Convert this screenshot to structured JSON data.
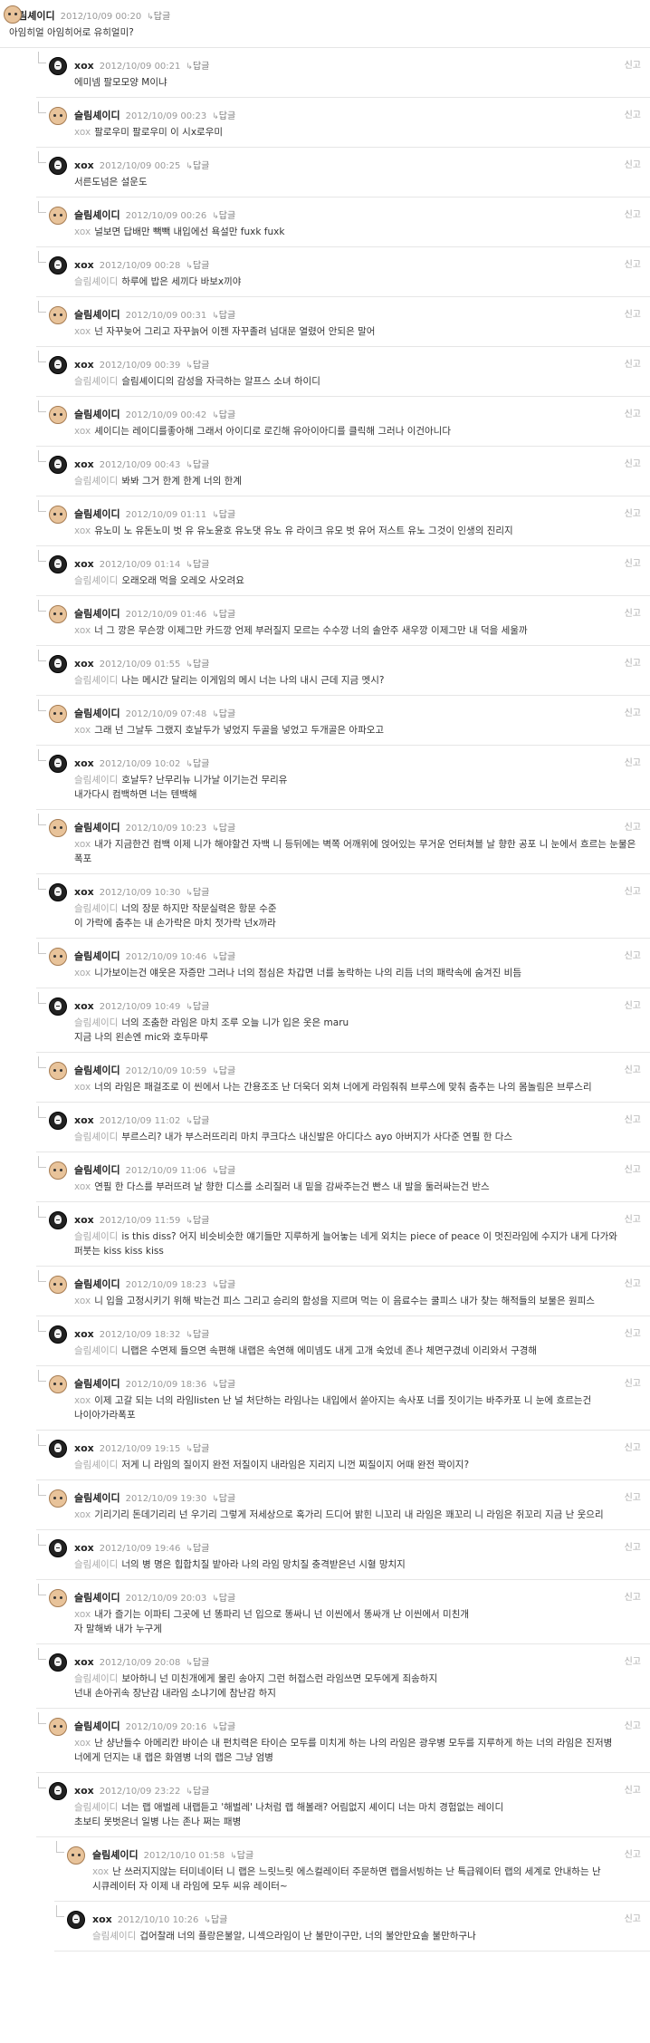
{
  "report_label": "신고",
  "reply_label": "답글",
  "reply_icon": "↳",
  "comments": [
    {
      "depth": 0,
      "author": "슬림셰이디",
      "avatar": "slim",
      "date": "2012/10/09 00:20",
      "report": false,
      "mention": "",
      "text": "아임히얼 아임히어로 유히얼미?"
    },
    {
      "depth": 1,
      "author": "xox",
      "avatar": "xox",
      "date": "2012/10/09 00:21",
      "report": true,
      "mention": "",
      "text": "에미넴 팔모모양 M이냐"
    },
    {
      "depth": 1,
      "author": "슬림셰이디",
      "avatar": "slim",
      "date": "2012/10/09 00:23",
      "report": true,
      "mention": "xox",
      "text": "팔로우미 팔로우미 이 시x로우미"
    },
    {
      "depth": 1,
      "author": "xox",
      "avatar": "xox",
      "date": "2012/10/09 00:25",
      "report": true,
      "mention": "",
      "text": "서른도넘은 설운도"
    },
    {
      "depth": 1,
      "author": "슬림셰이디",
      "avatar": "slim",
      "date": "2012/10/09 00:26",
      "report": true,
      "mention": "xox",
      "text": "널보면 답배만 빽빽 내입에선 욕설만 fuxk fuxk"
    },
    {
      "depth": 1,
      "author": "xox",
      "avatar": "xox",
      "date": "2012/10/09 00:28",
      "report": true,
      "mention": "슬림셰이디",
      "text": "하루에 밥은 세끼다 바보x끼야"
    },
    {
      "depth": 1,
      "author": "슬림셰이디",
      "avatar": "slim",
      "date": "2012/10/09 00:31",
      "report": true,
      "mention": "xox",
      "text": "넌 자꾸늦어 그리고 자꾸늙어 이젠 자꾸졸려 넘대문 열렸어 안되은 말어"
    },
    {
      "depth": 1,
      "author": "xox",
      "avatar": "xox",
      "date": "2012/10/09 00:39",
      "report": true,
      "mention": "슬림셰이디",
      "text": "슬림셰이디의 감성을 자극하는 알프스 소녀 하이디"
    },
    {
      "depth": 1,
      "author": "슬림셰이디",
      "avatar": "slim",
      "date": "2012/10/09 00:42",
      "report": true,
      "mention": "xox",
      "text": "셰이디는 레이디를좋아해 그래서 아이디로 로긴해 유아이아디를 클릭해 그러나 이건아니다"
    },
    {
      "depth": 1,
      "author": "xox",
      "avatar": "xox",
      "date": "2012/10/09 00:43",
      "report": true,
      "mention": "슬림셰이디",
      "text": "봐봐 그거 한계 한계 너의 한계"
    },
    {
      "depth": 1,
      "author": "슬림셰이디",
      "avatar": "slim",
      "date": "2012/10/09 01:11",
      "report": true,
      "mention": "xox",
      "text": "유노미 노 유돈노미 벗 유 유노윤호 유노댓 유노 유 라이크 유모 벗 유어 저스트 유노 그것이 인생의 진리지"
    },
    {
      "depth": 1,
      "author": "xox",
      "avatar": "xox",
      "date": "2012/10/09 01:14",
      "report": true,
      "mention": "슬림셰이디",
      "text": "오래오래 먹을 오레오 사오려요"
    },
    {
      "depth": 1,
      "author": "슬림셰이디",
      "avatar": "slim",
      "date": "2012/10/09 01:46",
      "report": true,
      "mention": "xox",
      "text": "너 그 깡은 무슨깡 이제그만 카드깡 언제 부러질지 모르는 수수깡 너의 솔안주 새우깡 이제그만 내 덕을 세울까"
    },
    {
      "depth": 1,
      "author": "xox",
      "avatar": "xox",
      "date": "2012/10/09 01:55",
      "report": true,
      "mention": "슬림셰이디",
      "text": "나는 메시간 달리는 이게임의 메시 너는 나의 내시 근데 지금 멧시?"
    },
    {
      "depth": 1,
      "author": "슬림셰이디",
      "avatar": "slim",
      "date": "2012/10/09 07:48",
      "report": true,
      "mention": "xox",
      "text": "그래 넌 그날두 그랬지 호날두가 넣었지 두골을 넣었고 두개골은 아파오고"
    },
    {
      "depth": 1,
      "author": "xox",
      "avatar": "xox",
      "date": "2012/10/09 10:02",
      "report": true,
      "mention": "슬림셰이디",
      "text": "호날두? 난무리뉴 니가날 이기는건 무리유\n내가다시 컴백하면 너는 텐백해"
    },
    {
      "depth": 1,
      "author": "슬림셰이디",
      "avatar": "slim",
      "date": "2012/10/09 10:23",
      "report": true,
      "mention": "xox",
      "text": "내가 지금한건 컴백 이제 니가 해야할건 자백 니 등뒤에는 벽쪽 어깨위에 얹어있는 무거운 언터쳐블 날 향한 공포 니 눈에서 흐르는 눈물은 폭포"
    },
    {
      "depth": 1,
      "author": "xox",
      "avatar": "xox",
      "date": "2012/10/09 10:30",
      "report": true,
      "mention": "슬림셰이디",
      "text": "너의 장문 하지만 작문실력은 항문 수준\n이 가락에 춤추는 내 손가락은 마치 젓가락 넌x까라"
    },
    {
      "depth": 1,
      "author": "슬림셰이디",
      "avatar": "slim",
      "date": "2012/10/09 10:46",
      "report": true,
      "mention": "xox",
      "text": "니가보이는건 얘웃은 자증만 그러나 너의 점심은 차갑면 너를 농락하는 나의 리듬 너의 패락속에 숨겨진 비듬"
    },
    {
      "depth": 1,
      "author": "xox",
      "avatar": "xox",
      "date": "2012/10/09 10:49",
      "report": true,
      "mention": "슬림셰이디",
      "text": "너의 조춤한 라임은 마치 조루 오늘 니가 입은 옷은 maru\n지금 나의 왼손엔 mic와 호두마루"
    },
    {
      "depth": 1,
      "author": "슬림셰이디",
      "avatar": "slim",
      "date": "2012/10/09 10:59",
      "report": true,
      "mention": "xox",
      "text": "너의 라임은 패걸조로 이 씬에서 나는 간용조조 난 더욱더 외쳐 너에게 라임줘줘 브루스에 맞춰 춤추는 나의 몸놀림은 브루스리"
    },
    {
      "depth": 1,
      "author": "xox",
      "avatar": "xox",
      "date": "2012/10/09 11:02",
      "report": true,
      "mention": "슬림셰이디",
      "text": "부르스리? 내가 부스러뜨리리 마치 쿠크다스 내신발은 아디다스 ayo 아버지가 사다준 연필 한 다스"
    },
    {
      "depth": 1,
      "author": "슬림셰이디",
      "avatar": "slim",
      "date": "2012/10/09 11:06",
      "report": true,
      "mention": "xox",
      "text": "연필 한 다스를 부러뜨려 날 향한 디스를 소리질러 내 밑을 감싸주는건 빤스 내 발을 둘러싸는건 반스"
    },
    {
      "depth": 1,
      "author": "xox",
      "avatar": "xox",
      "date": "2012/10/09 11:59",
      "report": true,
      "mention": "슬림셰이디",
      "text": "is this diss? 어지 비슷비슷한 얘기들만 지루하게 늘어놓는 네게 외치는 piece of peace 이 멋진라임에 수지가 내게 다가와 퍼붓는 kiss kiss kiss"
    },
    {
      "depth": 1,
      "author": "슬림셰이디",
      "avatar": "slim",
      "date": "2012/10/09 18:23",
      "report": true,
      "mention": "xox",
      "text": "니 입을 고정시키기 위해 박는건 피스 그리고 승리의 함성을 지르며 먹는 이 음료수는 쿨피스 내가 찾는 해적들의 보물은 원피스"
    },
    {
      "depth": 1,
      "author": "xox",
      "avatar": "xox",
      "date": "2012/10/09 18:32",
      "report": true,
      "mention": "슬림셰이디",
      "text": "니랩은 수면제 들으면 속편해 내랩은 속연해 에미넴도 내게 고개 숙었네 존나 체면구겼네 이리와서 구경해"
    },
    {
      "depth": 1,
      "author": "슬림셰이디",
      "avatar": "slim",
      "date": "2012/10/09 18:36",
      "report": true,
      "mention": "xox",
      "text": "이제 고갈 되는 너의 라임listen 난 널 처단하는 라임나는 내입에서 쏟아지는 속사포 너를 짓이기는 바주카포 니 눈에 흐르는건 나이아가라폭포"
    },
    {
      "depth": 1,
      "author": "xox",
      "avatar": "xox",
      "date": "2012/10/09 19:15",
      "report": true,
      "mention": "슬림셰이디",
      "text": "저게 니 라임의 질이지 완전 저질이지 내라임은 지리지 니껀 찌질이지 어때 완전 꽉이지?"
    },
    {
      "depth": 1,
      "author": "슬림셰이디",
      "avatar": "slim",
      "date": "2012/10/09 19:30",
      "report": true,
      "mention": "xox",
      "text": "기리기리 돈데기리리 넌 우기리 그렇게 저세상으로 혹가리 드디어 밝힌 니꼬리 내 라임은 꽤꼬리 니 라임은 쥐꼬리 지금 난 웃으리"
    },
    {
      "depth": 1,
      "author": "xox",
      "avatar": "xox",
      "date": "2012/10/09 19:46",
      "report": true,
      "mention": "슬림셰이디",
      "text": "너의 병 명은 힙합치질 밭아라 나의 라임 망치질 충격받은넌 시혈 망치지"
    },
    {
      "depth": 1,
      "author": "슬림셰이디",
      "avatar": "slim",
      "date": "2012/10/09 20:03",
      "report": true,
      "mention": "xox",
      "text": "내가 즐기는 이파티 그곳에 넌 똥파리 넌 입으로 똥싸니 넌 이씬에서 똥싸개 난 이씬에서 미친개\n자 말해봐 내가 누구게"
    },
    {
      "depth": 1,
      "author": "xox",
      "avatar": "xox",
      "date": "2012/10/09 20:08",
      "report": true,
      "mention": "슬림셰이디",
      "text": "보아하니 넌 미친개에게 물린 송아지 그런 허접스런 라임쓰면 모두에게 죄송하지\n넌내 손아귀속 장난감 내라임 소냐기에 참난감 하지"
    },
    {
      "depth": 1,
      "author": "슬림셰이디",
      "avatar": "slim",
      "date": "2012/10/09 20:16",
      "report": true,
      "mention": "xox",
      "text": "난 샹난들수 아메리칸 바이슨 내 펀치력은 타이슨 모두를 미치게 하는 나의 라임은 광우병 모두를 지루하게 하는 너의 라임은 진저병 너에게 던지는 내 랩은 화염병 너의 랩은 그냥 엄병"
    },
    {
      "depth": 1,
      "author": "xox",
      "avatar": "xox",
      "date": "2012/10/09 23:22",
      "report": true,
      "mention": "슬림셰이디",
      "text": "너는 랩 애벌레 내랩듣고 '해벌레' 나처럼 랩 해볼래? 어림없지 셰이디 너는 마치 경험없는 레이디\n초보티 못벗은너 일병 나는 존나 쩌는 패병"
    },
    {
      "depth": 2,
      "author": "슬림셰이디",
      "avatar": "slim",
      "date": "2012/10/10 01:58",
      "report": true,
      "mention": "xox",
      "text": "난 쓰러지지않는 터미네이터 니 랩은 느릿느릿 에스컬레이터 주문하면 랩을서빙하는 난 특급웨이터 랩의 세계로 안내하는 난 시큐레이터 자 이제 내 라임에 모두 씨유 레이터~"
    },
    {
      "depth": 2,
      "author": "xox",
      "avatar": "xox",
      "date": "2012/10/10 10:26",
      "report": true,
      "mention": "슬림셰이디",
      "text": "겁어찰래 너의 플랑은불알, 니섹으라임이 난 불만이구만, 너의 불안만요솔 불만하구나"
    }
  ]
}
